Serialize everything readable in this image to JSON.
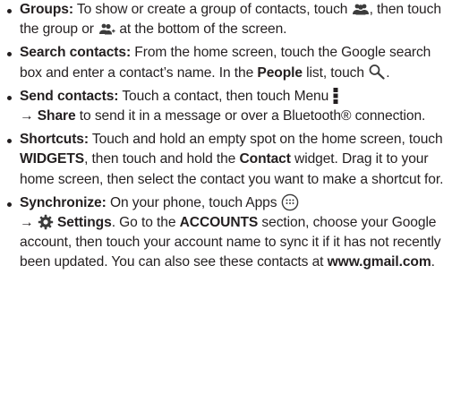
{
  "items": [
    {
      "term": "Groups:",
      "parts": {
        "a": " To show or create a group of contacts, touch ",
        "b": ", then touch the group or ",
        "c": " at the bottom of the screen."
      }
    },
    {
      "term": "Search contacts:",
      "parts": {
        "a": " From the home screen, touch the Google search box and enter a contact’s name. In the ",
        "b_bold": "People",
        "c": " list, touch ",
        "d": "."
      }
    },
    {
      "term": "Send contacts:",
      "parts": {
        "a": " Touch a contact, then touch Menu ",
        "arrow": " → ",
        "b_bold": "Share",
        "c": " to send it in a message or over a Bluetooth® connection."
      }
    },
    {
      "term": "Shortcuts:",
      "parts": {
        "a": " Touch and hold an empty spot on the home screen, touch ",
        "b_bold": "WIDGETS",
        "c": ", then touch and hold the ",
        "d_bold": "Contact",
        "e": " widget. Drag it to your home screen, then select the contact you want to make a shortcut for."
      }
    },
    {
      "term": "Synchronize:",
      "parts": {
        "a": " On your phone, touch Apps ",
        "arrow": " → ",
        "b_bold": "Settings",
        "c": ". Go to the ",
        "d_bold": "ACCOUNTS",
        "e": " section, choose your Google account, then touch your account name to sync it if it has not recently been updated. You can also see these contacts at ",
        "f_bold": "www.gmail.com",
        "g": "."
      }
    }
  ],
  "icons": {
    "groups": "groups-icon",
    "add_group": "add-group-icon",
    "search": "search-icon",
    "menu": "menu-icon",
    "apps": "apps-icon",
    "settings": "settings-icon"
  }
}
